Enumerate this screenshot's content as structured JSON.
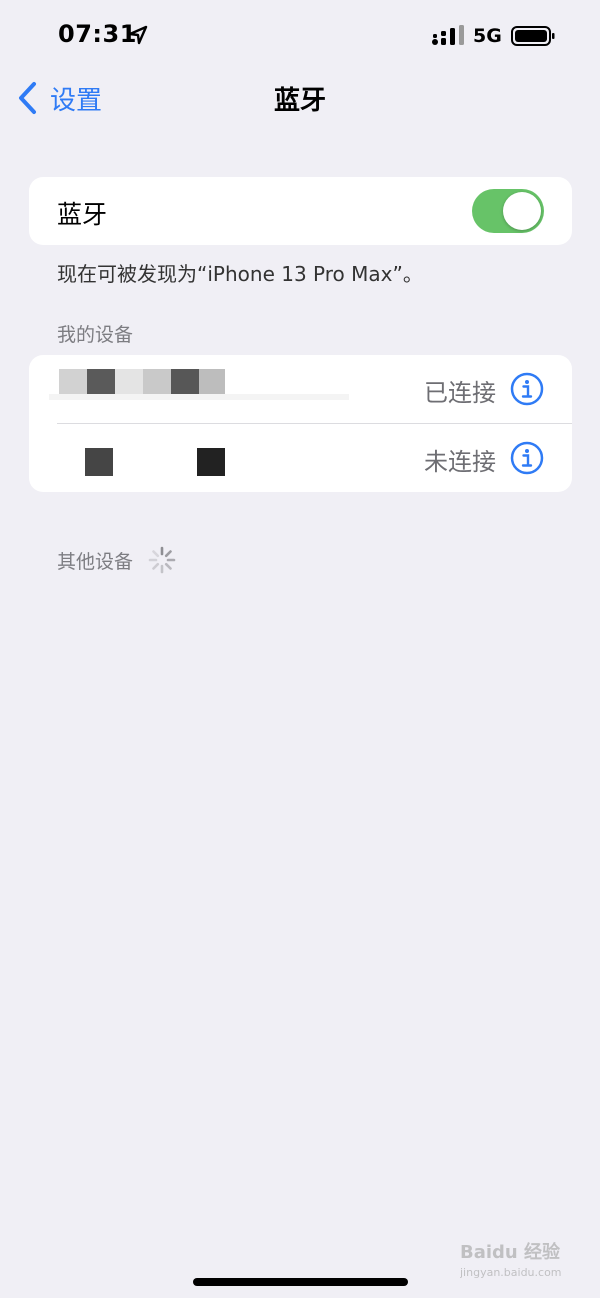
{
  "status_bar": {
    "time": "07:31",
    "network": "5G",
    "location_icon": "location-arrow-icon",
    "signal_icon": "cellular-signal-icon",
    "battery_icon": "battery-full-icon"
  },
  "nav": {
    "back_label": "设置",
    "title": "蓝牙",
    "back_icon": "chevron-left-icon"
  },
  "bluetooth": {
    "label": "蓝牙",
    "enabled": true,
    "toggle_color": "#67c368"
  },
  "discoverable_text": "现在可被发现为“iPhone 13 Pro Max”。",
  "my_devices": {
    "header": "我的设备",
    "items": [
      {
        "status": "已连接",
        "info_icon": "info-circle-icon"
      },
      {
        "status": "未连接",
        "info_icon": "info-circle-icon"
      }
    ]
  },
  "other_devices": {
    "header": "其他设备",
    "spinner_icon": "loading-spinner-icon"
  },
  "watermark": {
    "text": "Baidu 经验",
    "sub": "jingyan.baidu.com"
  },
  "colors": {
    "accent": "#2f7bf5",
    "background": "#f0eff5"
  }
}
